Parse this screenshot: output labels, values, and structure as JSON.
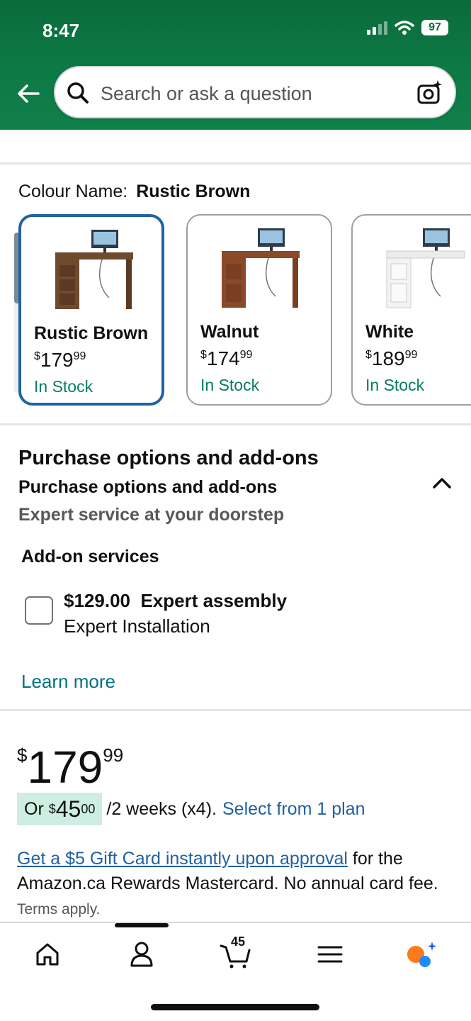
{
  "status": {
    "time": "8:47",
    "battery": "97"
  },
  "search": {
    "placeholder": "Search or ask a question"
  },
  "colour": {
    "label": "Colour Name:",
    "selected": "Rustic Brown",
    "options": [
      {
        "name": "Rustic Brown",
        "currency": "$",
        "whole": "179",
        "fraction": "99",
        "stock": "In Stock",
        "color": "#6e4a2e"
      },
      {
        "name": "Walnut",
        "currency": "$",
        "whole": "174",
        "fraction": "99",
        "stock": "In Stock",
        "color": "#8a4a2a"
      },
      {
        "name": "White",
        "currency": "$",
        "whole": "189",
        "fraction": "99",
        "stock": "In Stock",
        "color": "#f1f1f1"
      }
    ]
  },
  "purchase": {
    "title": "Purchase options and add-ons",
    "subtitle": "Purchase options and add-ons",
    "description": "Expert service at your doorstep",
    "addon_heading": "Add-on services",
    "addon_price": "$129.00",
    "addon_title": "Expert assembly",
    "addon_detail": "Expert Installation",
    "learn_more": "Learn more"
  },
  "price": {
    "currency": "$",
    "whole": "179",
    "fraction": "99",
    "plan_prefix": "Or",
    "plan_currency": "$",
    "plan_whole": "45",
    "plan_fraction": "00",
    "plan_period": "/2 weeks (x4).",
    "plan_link": "Select from 1 plan"
  },
  "promo": {
    "link": "Get a $5 Gift Card instantly upon approval",
    "text": "for the Amazon.ca Rewards Mastercard. No annual card fee.",
    "terms": "Terms apply."
  },
  "nav": {
    "cart_count": "45"
  },
  "colors": {
    "accent_blue": "#2162a1",
    "stock_green": "#067d62",
    "header_green": "#0a6b3b"
  }
}
